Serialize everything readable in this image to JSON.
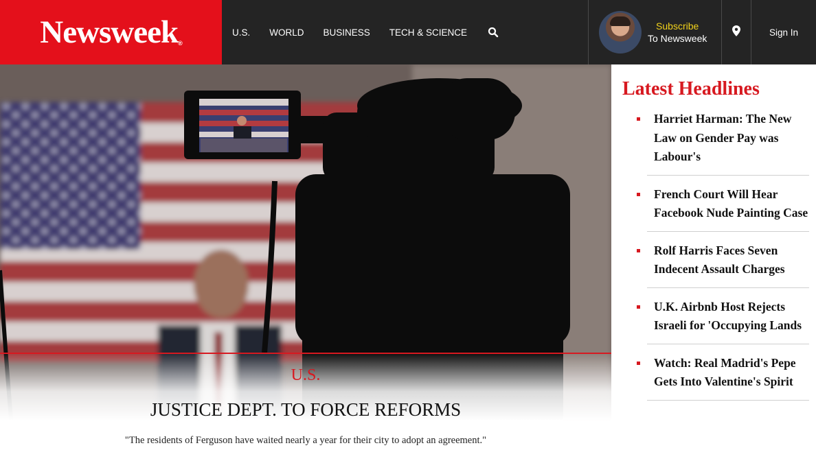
{
  "header": {
    "logo": "Newsweek",
    "nav": [
      "U.S.",
      "WORLD",
      "BUSINESS",
      "TECH & SCIENCE"
    ],
    "subscribe_line1": "Subscribe",
    "subscribe_line2": "To Newsweek",
    "sign_in": "Sign In"
  },
  "hero": {
    "kicker": "U.S.",
    "headline": "JUSTICE DEPT. TO FORCE REFORMS",
    "dek": "\"The residents of Ferguson have waited nearly a year for their city to adopt an agreement.\""
  },
  "sidebar": {
    "title": "Latest Headlines",
    "items": [
      {
        "label": "Harriet Harman: The New Law on Gender Pay was Labour's"
      },
      {
        "label": "French Court Will Hear Facebook Nude Painting Case"
      },
      {
        "label": "Rolf Harris Faces Seven Indecent Assault Charges"
      },
      {
        "label": "U.K. Airbnb Host Rejects Israeli for 'Occupying Lands"
      },
      {
        "label": "Watch: Real Madrid's Pepe Gets Into Valentine's Spirit"
      }
    ]
  },
  "colors": {
    "brand_red": "#e4101b",
    "header_bg": "#242424",
    "subscribe_yellow": "#f2d21b"
  },
  "icons": [
    "search-icon",
    "location-pin-icon"
  ]
}
